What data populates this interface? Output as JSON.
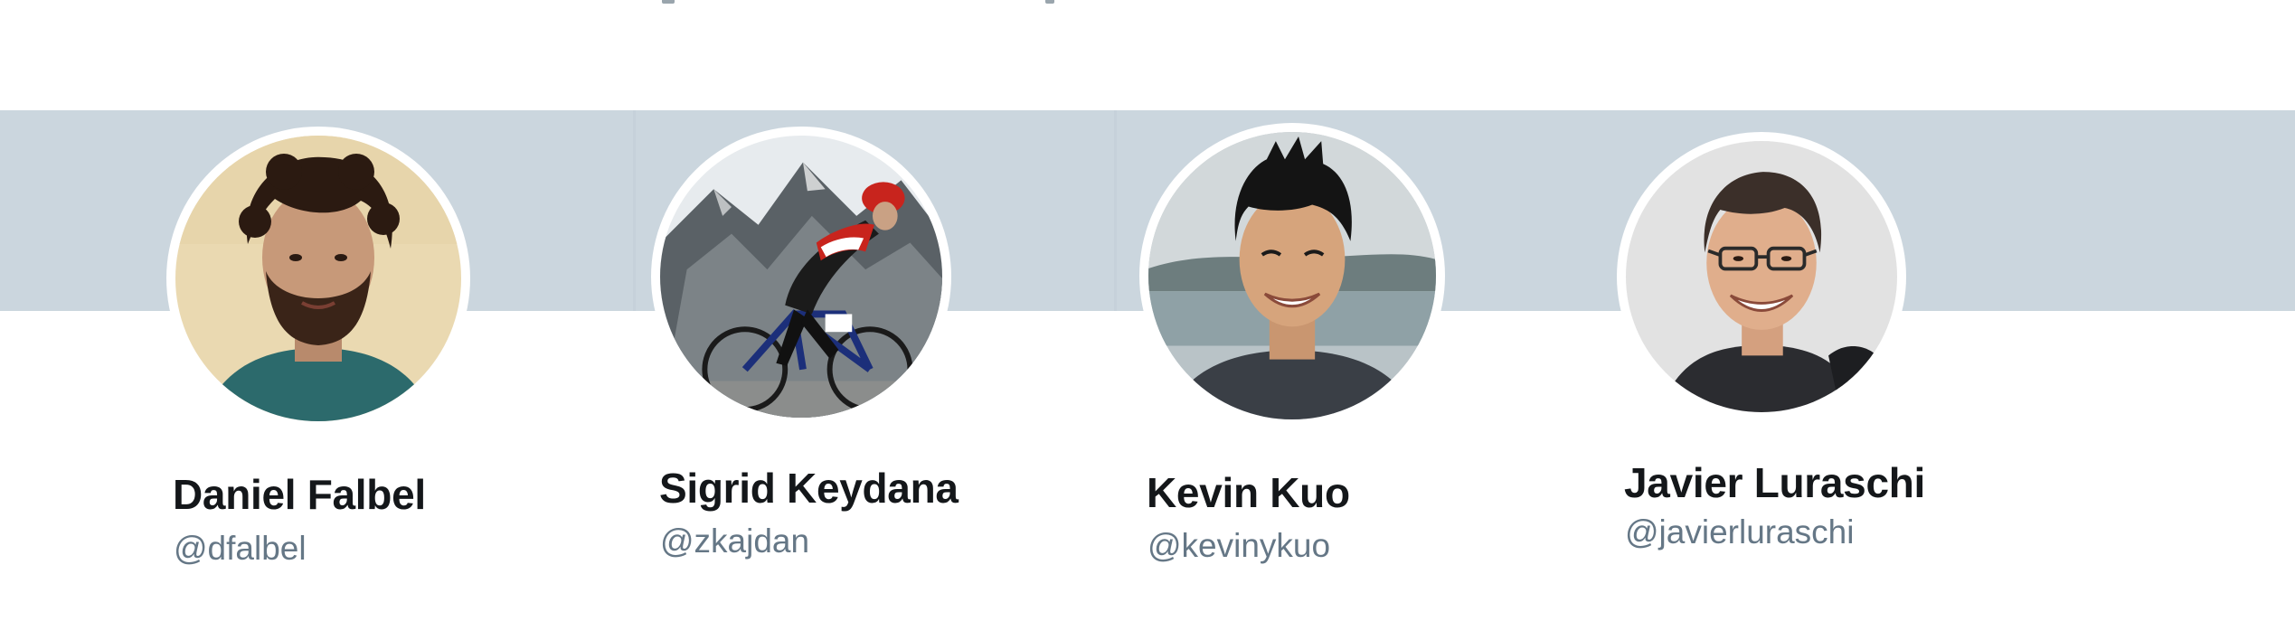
{
  "profiles": [
    {
      "name": "Daniel Falbel",
      "handle": "@dfalbel",
      "avatar_icon": "person-curly-hair-beard-avatar"
    },
    {
      "name": "Sigrid Keydana",
      "handle": "@zkajdan",
      "avatar_icon": "cyclist-mountain-avatar"
    },
    {
      "name": "Kevin Kuo",
      "handle": "@kevinykuo",
      "avatar_icon": "person-spiky-hair-avatar"
    },
    {
      "name": "Javier Luraschi",
      "handle": "@javierluraschi",
      "avatar_icon": "person-glasses-avatar"
    }
  ],
  "colors": {
    "banner": "#cbd6de",
    "name_text": "#14171a",
    "handle_text": "#657786",
    "avatar_ring": "#ffffff"
  }
}
